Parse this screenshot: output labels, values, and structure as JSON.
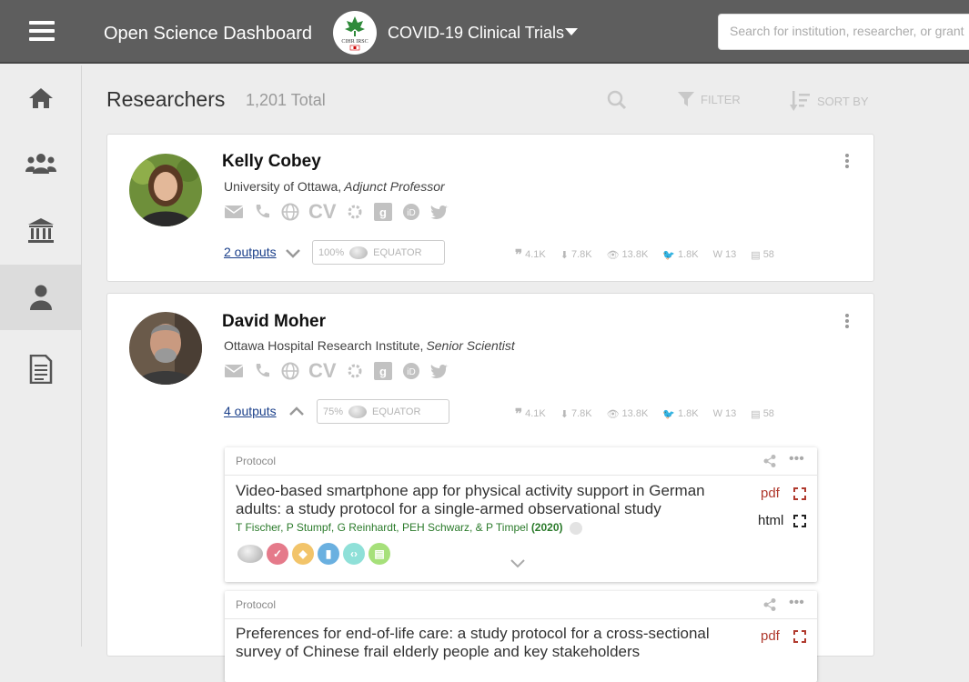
{
  "topbar": {
    "app_title": "Open Science Dashboard",
    "logo_text": "CIHR IRSC",
    "project": "COVID-19 Clinical Trials",
    "search_placeholder": "Search for institution, researcher, or grant"
  },
  "sidebar": {
    "items": [
      {
        "name": "home",
        "icon": "home-icon"
      },
      {
        "name": "groups",
        "icon": "users-icon"
      },
      {
        "name": "institutions",
        "icon": "institution-icon"
      },
      {
        "name": "researchers",
        "icon": "person-icon",
        "active": true
      },
      {
        "name": "documents",
        "icon": "document-icon"
      }
    ]
  },
  "header": {
    "title": "Researchers",
    "total": "1,201 Total",
    "filter_label": "FILTER",
    "sort_label": "SORT BY"
  },
  "researchers": [
    {
      "name": "Kelly Cobey",
      "institution": "University of Ottawa,",
      "role": "Adjunct Professor",
      "outputs": "2 outputs",
      "equator_pct": "100%",
      "equator_label": "EQUATOR",
      "metrics": {
        "citations": "4.1K",
        "downloads": "7.8K",
        "views": "13.8K",
        "tweets": "1.8K",
        "wiki": "13",
        "news": "58"
      }
    },
    {
      "name": "David Moher",
      "institution": "Ottawa Hospital Research Institute,",
      "role": "Senior Scientist",
      "outputs": "4 outputs",
      "equator_pct": "75%",
      "equator_label": "EQUATOR",
      "metrics": {
        "citations": "4.1K",
        "downloads": "7.8K",
        "views": "13.8K",
        "tweets": "1.8K",
        "wiki": "13",
        "news": "58"
      }
    }
  ],
  "output_cards": [
    {
      "type": "Protocol",
      "title": "Video-based smartphone app for physical activity support in German adults: a study protocol for a single-armed observational study",
      "authors": "T Fischer, P Stumpf, G Reinhardt, PEH Schwarz, & P Timpel",
      "year": "(2020)",
      "formats": [
        "pdf",
        "html"
      ]
    },
    {
      "type": "Protocol",
      "title": "Preferences for end-of-life care: a study protocol for a cross-sectional survey of Chinese frail elderly people and key stakeholders",
      "formats": [
        "pdf"
      ]
    }
  ],
  "colors": {
    "topbar": "#5e5e5e",
    "link": "#1a3f8a",
    "pdf": "#b03a2e",
    "authors": "#2a7a2a"
  }
}
